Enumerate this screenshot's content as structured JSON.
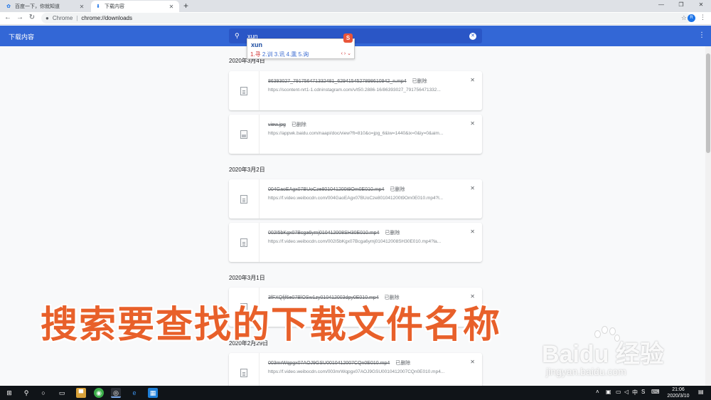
{
  "browser": {
    "tabs": [
      {
        "title": "百度一下，你就知道",
        "active": false,
        "icon": "baidu-paw-icon"
      },
      {
        "title": "下载内容",
        "active": true,
        "icon": "download-icon"
      }
    ],
    "new_tab": "+",
    "omnibox": {
      "scheme_label": "Chrome",
      "separator": "|",
      "url": "chrome://downloads"
    },
    "avatar_letter": "R"
  },
  "downloads": {
    "title": "下载内容",
    "search_value": "xun",
    "ime": {
      "pinyin": "xun",
      "candidates_first": "1.寻",
      "candidates_rest": " 2.训 3.讯 4.熏 5.询",
      "arrows": "‹ › ⌄",
      "logo": "S"
    },
    "groups": [
      {
        "date": "2020年3月4日",
        "items": [
          {
            "name": "86393027_791756471332481_6294154527898610942_n.mp4",
            "status": "已删除",
            "url": "https://scontent-nrt1-1.cdninstagram.com/v/t50.2886-16/86393027_791756471332...",
            "kind": "file"
          },
          {
            "name": "view.jpg",
            "status": "已删除",
            "url": "https://appwk.baidu.com/naapi/doc/view?ft=810&o=jpg_6&iw=1440&ix=0&iy=0&aim...",
            "kind": "image"
          }
        ]
      },
      {
        "date": "2020年3月2日",
        "items": [
          {
            "name": "004GaoEAgx07BUoCze801041200t9Om0E010.mp4",
            "status": "已删除",
            "url": "https://f.video.weibocdn.com/004GaoEAgx07BUoCze801041200t9Om0E010.mp4?l...",
            "kind": "file"
          },
          {
            "name": "002I5bKgx07Bcga6ymj010412008SH30E010.mp4",
            "status": "已删除",
            "url": "https://f.video.weibocdn.com/002I5bKgx07Bcga6ymj010412008SH30E010.mp4?la...",
            "kind": "file"
          }
        ]
      },
      {
        "date": "2020年3月1日",
        "items": [
          {
            "name": "3fFXQfjf6e07BlOSw1zy010412003dpy0E010.mp4",
            "status": "已删除",
            "url": "",
            "kind": "file"
          }
        ]
      },
      {
        "date": "2020年2月29日",
        "items": [
          {
            "name": "003mrWqpgx07AOJ9GSU0010412007CQn0E010.mp4",
            "status": "已删除",
            "url": "https://f.video.weibocdn.com/003mrWqpgx07AOJ9GSU0010412007CQn0E010.mp4...",
            "kind": "file"
          }
        ]
      }
    ]
  },
  "overlay": {
    "caption": "搜索要查找的下载文件名称",
    "watermark_brand": "Baidu 经验",
    "watermark_site": "jingyan.baidu.com"
  },
  "taskbar": {
    "ime_label": "中",
    "lang_icon": "S",
    "time": "21:06",
    "date": "2020/3/10"
  },
  "colors": {
    "header_blue": "#3367d6",
    "caption_orange": "#e8602a"
  }
}
